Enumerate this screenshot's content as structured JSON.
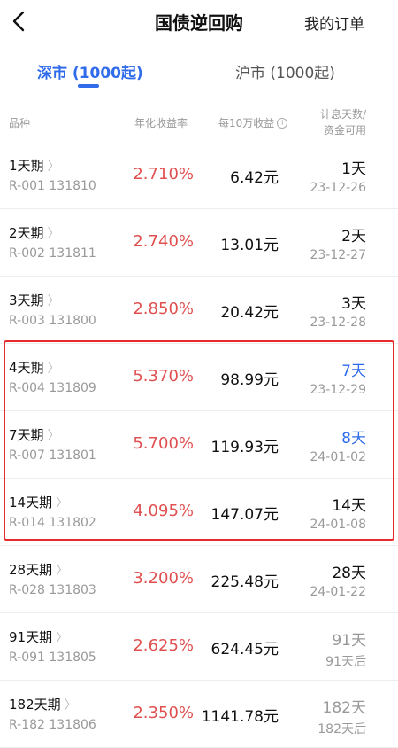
{
  "header": {
    "title": "国债逆回购",
    "orders_label": "我的订单"
  },
  "tabs": [
    {
      "label": "深市 (1000起)",
      "active": true
    },
    {
      "label": "沪市 (1000起)",
      "active": false
    }
  ],
  "columns": {
    "variety": "品种",
    "annual_rate": "年化收益率",
    "per_100k": "每10万收益",
    "interest_days_line1": "计息天数/",
    "interest_days_line2": "资金可用"
  },
  "rows": [
    {
      "name": "1天期",
      "code": "R-001 131810",
      "rate": "2.710%",
      "income": "6.42元",
      "days": "1天",
      "date": "23-12-26",
      "days_style": "normal"
    },
    {
      "name": "2天期",
      "code": "R-002 131811",
      "rate": "2.740%",
      "income": "13.01元",
      "days": "2天",
      "date": "23-12-27",
      "days_style": "normal"
    },
    {
      "name": "3天期",
      "code": "R-003 131800",
      "rate": "2.850%",
      "income": "20.42元",
      "days": "3天",
      "date": "23-12-28",
      "days_style": "normal"
    },
    {
      "name": "4天期",
      "code": "R-004 131809",
      "rate": "5.370%",
      "income": "98.99元",
      "days": "7天",
      "date": "23-12-29",
      "days_style": "blue"
    },
    {
      "name": "7天期",
      "code": "R-007 131801",
      "rate": "5.700%",
      "income": "119.93元",
      "days": "8天",
      "date": "24-01-02",
      "days_style": "blue"
    },
    {
      "name": "14天期",
      "code": "R-014 131802",
      "rate": "4.095%",
      "income": "147.07元",
      "days": "14天",
      "date": "24-01-08",
      "days_style": "normal"
    },
    {
      "name": "28天期",
      "code": "R-028 131803",
      "rate": "3.200%",
      "income": "225.48元",
      "days": "28天",
      "date": "24-01-22",
      "days_style": "normal"
    },
    {
      "name": "91天期",
      "code": "R-091 131805",
      "rate": "2.625%",
      "income": "624.45元",
      "days": "91天",
      "date": "91天后",
      "days_style": "gray"
    },
    {
      "name": "182天期",
      "code": "R-182 131806",
      "rate": "2.350%",
      "income": "1141.78元",
      "days": "182天",
      "date": "182天后",
      "days_style": "gray"
    }
  ],
  "colors": {
    "accent": "#2f6bea",
    "rate": "#e05050",
    "highlight_border": "#e52b2b"
  }
}
